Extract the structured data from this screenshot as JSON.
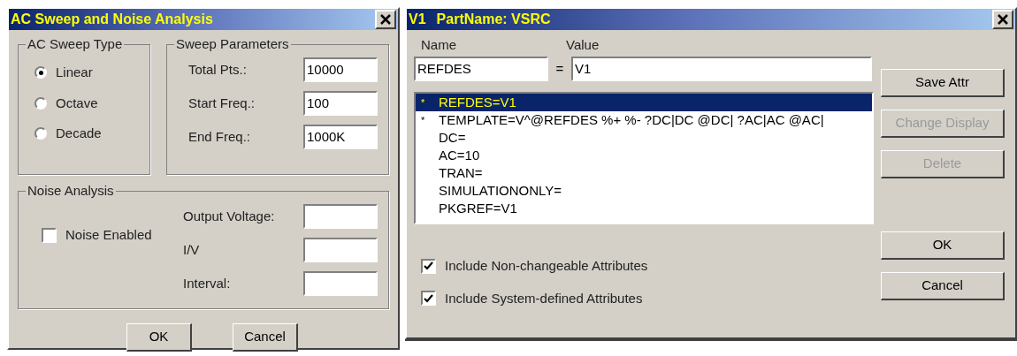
{
  "ac_dialog": {
    "title": "AC Sweep and Noise Analysis",
    "sweep_type": {
      "label": "AC Sweep Type",
      "options": [
        {
          "label": "Linear",
          "selected": true
        },
        {
          "label": "Octave",
          "selected": false
        },
        {
          "label": "Decade",
          "selected": false
        }
      ]
    },
    "sweep_parameters": {
      "label": "Sweep Parameters",
      "fields": [
        {
          "label": "Total Pts.:",
          "value": "10000"
        },
        {
          "label": "Start Freq.:",
          "value": "100"
        },
        {
          "label": "End Freq.:",
          "value": "1000K"
        }
      ]
    },
    "noise_analysis": {
      "label": "Noise Analysis",
      "checkbox": {
        "label": "Noise Enabled",
        "checked": false
      },
      "fields": [
        {
          "label": "Output Voltage:"
        },
        {
          "label": "I/V"
        },
        {
          "label": "Interval:"
        }
      ]
    },
    "buttons": [
      {
        "label": "OK"
      },
      {
        "label": "Cancel"
      }
    ]
  },
  "attribute_dialog": {
    "ref": "V1",
    "title": "PartName: VSRC",
    "name_label": "Name",
    "value_label": "Value",
    "name_value": "REFDES",
    "equals": "=",
    "value_value": "V1",
    "attributes": [
      {
        "marker": "*",
        "text": "REFDES=V1",
        "selected": true
      },
      {
        "marker": "*",
        "text": "TEMPLATE=V^@REFDES %+ %- ?DC|DC @DC| ?AC|AC @AC|",
        "selected": false
      },
      {
        "text": "DC=",
        "selected": false
      },
      {
        "text": "AC=10",
        "selected": false
      },
      {
        "text": "TRAN=",
        "selected": false
      },
      {
        "text": "SIMULATIONONLY=",
        "selected": false
      },
      {
        "text": "PKGREF=V1",
        "selected": false
      }
    ],
    "side_buttons": [
      {
        "label": "Save Attr",
        "disabled": false
      },
      {
        "label": "Change Display",
        "disabled": true
      },
      {
        "label": "Delete",
        "disabled": true
      }
    ],
    "options": [
      {
        "label": "Include Non-changeable Attributes",
        "checked": true
      },
      {
        "label": "Include System-defined Attributes",
        "checked": true
      }
    ],
    "buttons": [
      {
        "label": "OK"
      },
      {
        "label": "Cancel"
      }
    ]
  }
}
